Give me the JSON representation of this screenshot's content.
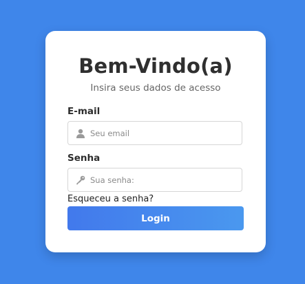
{
  "login": {
    "title": "Bem-Vindo(a)",
    "subtitle": "Insira seus dados de acesso",
    "email_label": "E-mail",
    "email_placeholder": "Seu email",
    "email_value": "",
    "password_label": "Senha",
    "password_placeholder": "Sua senha:",
    "password_value": "",
    "forgot_link": "Esqueceu a senha?",
    "submit_label": "Login"
  },
  "icons": {
    "email_field": "user-icon",
    "password_field": "key-icon"
  },
  "colors": {
    "background": "#3f86ea",
    "button_gradient_start": "#4279ec",
    "button_gradient_end": "#4a98ef",
    "card": "#ffffff"
  }
}
